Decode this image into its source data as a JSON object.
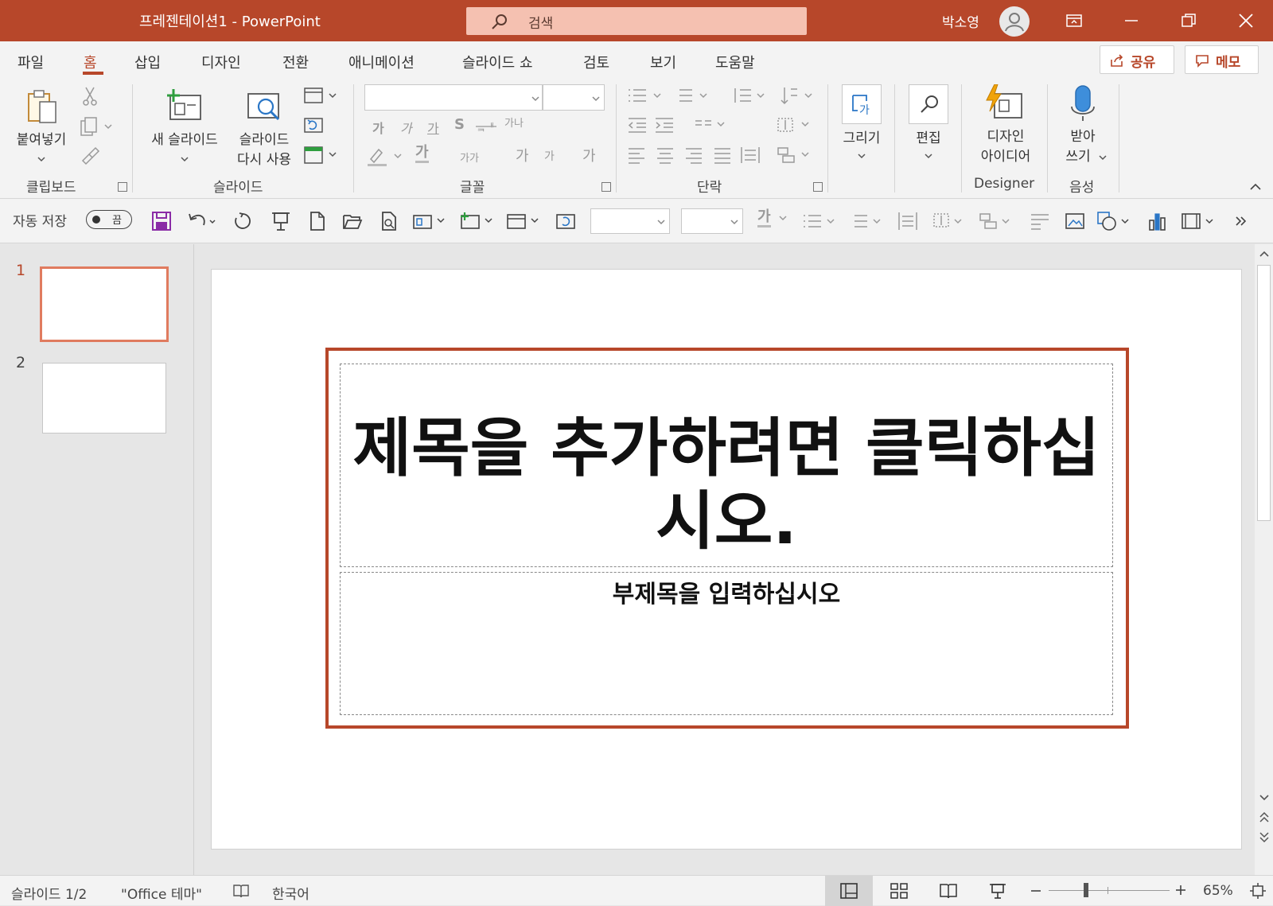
{
  "window": {
    "title": "프레젠테이션1  -  PowerPoint",
    "search_placeholder": "검색",
    "user_name": "박소영"
  },
  "menu": {
    "tabs": [
      "파일",
      "홈",
      "삽입",
      "디자인",
      "전환",
      "애니메이션",
      "슬라이드 쇼",
      "검토",
      "보기",
      "도움말"
    ],
    "active_tab": "홈",
    "share_label": "공유",
    "memo_label": "메모"
  },
  "ribbon": {
    "clipboard": {
      "paste_label": "붙여넣기",
      "group_label": "클립보드"
    },
    "slides": {
      "new_slide_label": "새 슬라이드",
      "reuse_label_1": "슬라이드",
      "reuse_label_2": "다시 사용",
      "group_label": "슬라이드"
    },
    "font": {
      "group_label": "글꼴",
      "font_name": "",
      "font_size": "",
      "bold_sample": "가",
      "italic_sample": "가",
      "underline_sample": "가",
      "strike_sample": "S",
      "spacing_sample": "가나",
      "color_sample": "가",
      "case_sample": "가가",
      "grow_sample": "가",
      "shrink_sample": "가",
      "clear_sample": "가"
    },
    "paragraph": {
      "group_label": "단락"
    },
    "drawing": {
      "label": "그리기"
    },
    "editing": {
      "label": "편집"
    },
    "designer": {
      "label_1": "디자인",
      "label_2": "아이디어",
      "group_label": "Designer"
    },
    "voice": {
      "label_1": "받아",
      "label_2": "쓰기",
      "group_label": "음성"
    }
  },
  "qat": {
    "autosave_label": "자동 저장",
    "autosave_state": "끔",
    "bold_sample": "가"
  },
  "slides_panel": {
    "slides": [
      {
        "number": "1",
        "selected": true
      },
      {
        "number": "2",
        "selected": false
      }
    ]
  },
  "slide": {
    "title_placeholder": "제목을 추가하려면 클릭하십시오.",
    "subtitle_placeholder": "부제목을 입력하십시오"
  },
  "status": {
    "slide_counter": "슬라이드 1/2",
    "theme": "\"Office 테마\"",
    "language": "한국어",
    "zoom": "65%"
  },
  "colors": {
    "accent": "#b7472a",
    "thumb_selected": "#e07b5f"
  }
}
